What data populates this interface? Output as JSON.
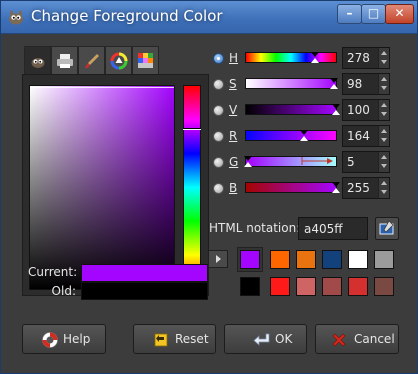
{
  "window": {
    "title": "Change Foreground Color"
  },
  "colors": {
    "current": "#a405ff",
    "old": "#000000",
    "accent": "#3d6fb8"
  },
  "selector_tabs": [
    {
      "icon": "gimp-scales-icon",
      "active": true
    },
    {
      "icon": "cmyk-printer-icon",
      "active": false
    },
    {
      "icon": "watercolor-brush-icon",
      "active": false
    },
    {
      "icon": "color-wheel-icon",
      "active": false
    },
    {
      "icon": "palette-icon",
      "active": false
    }
  ],
  "swatch_labels": {
    "current": "Current:",
    "old": "Old:"
  },
  "channels": [
    {
      "letter": "H",
      "value": "278",
      "selected": true
    },
    {
      "letter": "S",
      "value": "98",
      "selected": false
    },
    {
      "letter": "V",
      "value": "100",
      "selected": false
    },
    {
      "letter": "R",
      "value": "164",
      "selected": false
    },
    {
      "letter": "G",
      "value": "5",
      "selected": false
    },
    {
      "letter": "B",
      "value": "255",
      "selected": false
    }
  ],
  "channel_levels": {
    "H": 0.772,
    "S": 0.98,
    "V": 1.0,
    "R": 0.643,
    "G": 0.02,
    "B": 1.0
  },
  "html_notation": {
    "label": "HTML notation:",
    "value": "a405ff"
  },
  "history": [
    [
      "#a405ff",
      "#ff6600",
      "#e8730f",
      "#13417c",
      "#ffffff",
      "#9b9b9b"
    ],
    [
      "#000000",
      "#ff1a1a",
      "#cf6464",
      "#a04a4a",
      "#d43030",
      "#7a4a42"
    ]
  ],
  "buttons": {
    "help": "Help",
    "reset": "Reset",
    "ok": "OK",
    "cancel": "Cancel"
  }
}
